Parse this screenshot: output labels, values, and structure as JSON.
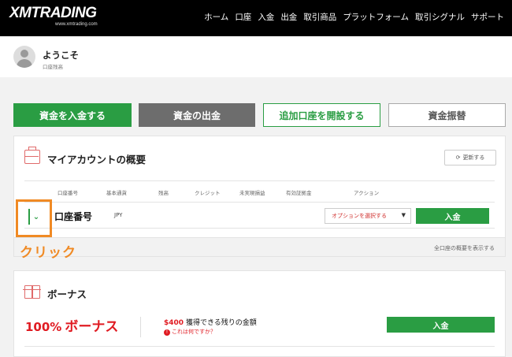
{
  "header": {
    "logo": "XMTRADING",
    "logo_sub": "www.xmtrading.com",
    "nav": [
      "ホーム",
      "口座",
      "入金",
      "出金",
      "取引商品",
      "プラットフォーム",
      "取引シグナル",
      "サポート"
    ]
  },
  "user": {
    "welcome": "ようこそ",
    "account_type": "口座残高"
  },
  "actions": {
    "deposit": "資金を入金する",
    "withdraw": "資金の出金",
    "open_account": "追加口座を開設する",
    "transfer": "資金振替"
  },
  "overview": {
    "title": "マイアカウントの概要",
    "update_label": "更新する",
    "columns": [
      "口座番号",
      "基本通貨",
      "残高",
      "クレジット",
      "未実現損益",
      "有効証拠金",
      "アクション"
    ],
    "row": {
      "account_label": "口座番号",
      "currency": "JPY",
      "action_select": "オプションを選択する",
      "deposit": "入金"
    },
    "show_all": "全口座の概要を表示する"
  },
  "annotation": {
    "click_label": "クリック"
  },
  "bonus": {
    "title": "ボーナス",
    "big_pct": "100%",
    "big_text": "ボーナス",
    "remaining_amount": "$400",
    "remaining_text": "獲得できる残りの金額",
    "what_is_this": "これは何ですか？",
    "deposit": "入金"
  },
  "colors": {
    "green": "#2a9d43",
    "red": "#e01b22",
    "orange": "#f08a24",
    "gray_button": "#6d6d6d"
  }
}
